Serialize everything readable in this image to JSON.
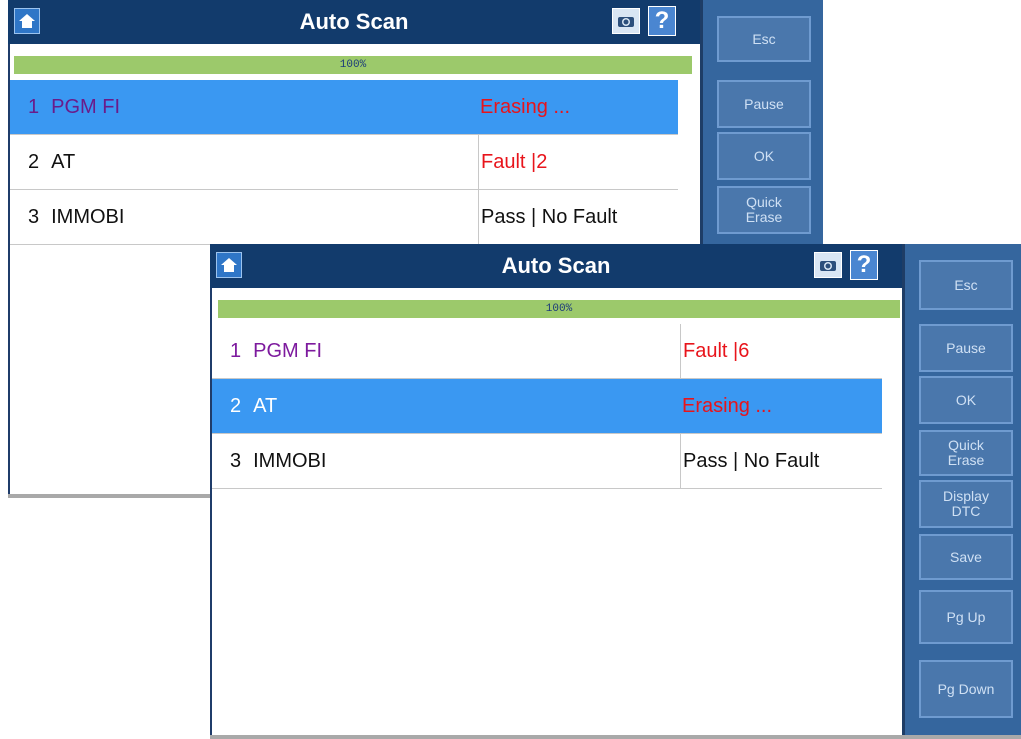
{
  "window_back": {
    "title": "Auto Scan",
    "progress": "100%",
    "rows": [
      {
        "num": "1",
        "name": "PGM FI",
        "status": "Erasing ..."
      },
      {
        "num": "2",
        "name": "AT",
        "status": "Fault |2"
      },
      {
        "num": "3",
        "name": "IMMOBI",
        "status": "Pass | No Fault"
      }
    ],
    "sidebar": [
      "Esc",
      "Pause",
      "OK",
      "Quick\nErase"
    ]
  },
  "window_front": {
    "title": "Auto Scan",
    "progress": "100%",
    "rows": [
      {
        "num": "1",
        "name": "PGM FI",
        "status": "Fault |6"
      },
      {
        "num": "2",
        "name": "AT",
        "status": "Erasing ..."
      },
      {
        "num": "3",
        "name": "IMMOBI",
        "status": "Pass | No Fault"
      }
    ],
    "sidebar": [
      "Esc",
      "Pause",
      "OK",
      "Quick\nErase",
      "Display\nDTC",
      "Save",
      "Pg Up",
      "Pg Down"
    ]
  },
  "icons": {
    "home": "home-icon",
    "camera": "camera-icon",
    "help": "?"
  },
  "colors": {
    "titlebar": "#123b6c",
    "selected_row": "#3a98f2",
    "progress": "#9cc96b",
    "sidebar": "#35669e",
    "fault": "#e8141b",
    "ecu_purple": "#7d1a9e"
  }
}
